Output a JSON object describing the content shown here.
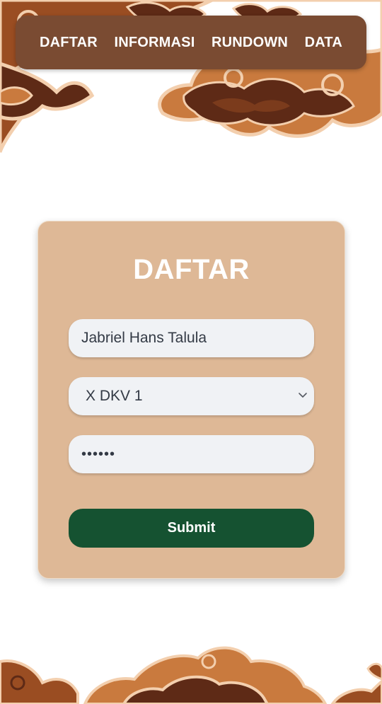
{
  "nav": {
    "items": [
      {
        "label": "DAFTAR"
      },
      {
        "label": "INFORMASI"
      },
      {
        "label": "RUNDOWN"
      },
      {
        "label": "DATA"
      }
    ]
  },
  "form": {
    "title": "DAFTAR",
    "name_value": "Jabriel Hans Talula",
    "class_value": "X DKV 1",
    "password_value": "••••••",
    "submit_label": "Submit"
  },
  "colors": {
    "nav_bg": "#7a4b32",
    "card_bg": "#deb896",
    "field_bg": "#f0f2f5",
    "submit_bg": "#155231",
    "batik_dark": "#5e2a16",
    "batik_mid": "#9a4d22",
    "batik_light": "#c97a3e",
    "batik_cream": "#f3cfae"
  },
  "icons": {
    "dropdown": "chevron-down-icon"
  }
}
